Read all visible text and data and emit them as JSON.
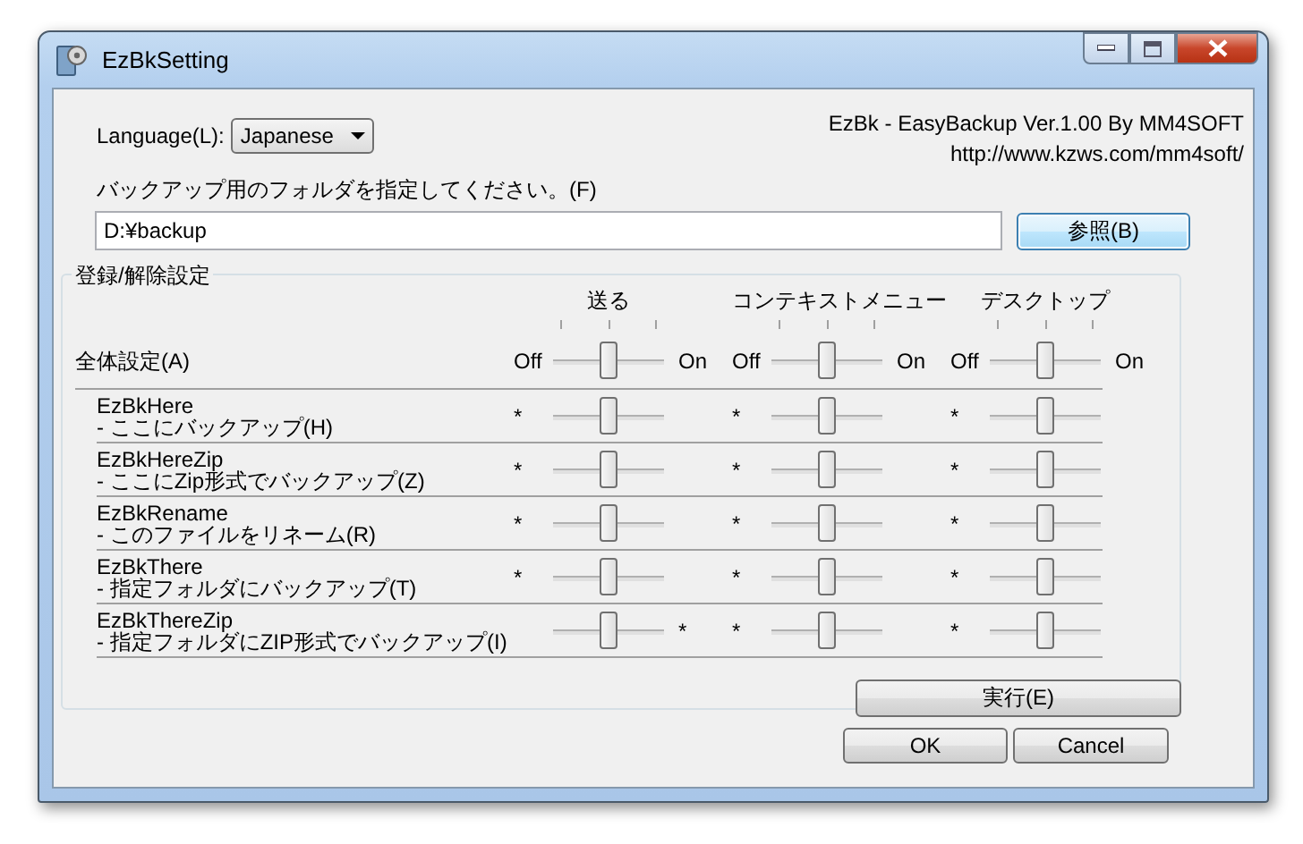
{
  "window": {
    "title": "EzBkSetting"
  },
  "language": {
    "label": "Language(L):",
    "value": "Japanese"
  },
  "about": [
    "EzBk - EasyBackup Ver.1.00 By MM4SOFT",
    "http://www.kzws.com/mm4soft/"
  ],
  "folder": {
    "label": "バックアップ用のフォルダを指定してください。(F)",
    "value": "D:¥backup",
    "browse_button": "参照(B)"
  },
  "group": {
    "title": "登録/解除設定",
    "columns": [
      "送る",
      "コンテキストメニュー",
      "デスクトップ"
    ],
    "all": {
      "label": "全体設定(A)",
      "cells": [
        {
          "left": "Off",
          "level": 0.5,
          "right": "On"
        },
        {
          "left": "Off",
          "level": 0.5,
          "right": "On"
        },
        {
          "left": "Off",
          "level": 0.5,
          "right": "On"
        }
      ]
    },
    "items": [
      {
        "name": "EzBkHere",
        "desc": "- ここにバックアップ(H)",
        "cells": [
          {
            "left": "*",
            "level": 0.5
          },
          {
            "left": "*",
            "level": 0.5
          },
          {
            "left": "*",
            "level": 0.5
          }
        ]
      },
      {
        "name": "EzBkHereZip",
        "desc": "- ここにZip形式でバックアップ(Z)",
        "cells": [
          {
            "left": "*",
            "level": 0.5
          },
          {
            "left": "*",
            "level": 0.5
          },
          {
            "left": "*",
            "level": 0.5
          }
        ]
      },
      {
        "name": "EzBkRename",
        "desc": "- このファイルをリネーム(R)",
        "cells": [
          {
            "left": "*",
            "level": 0.5
          },
          {
            "left": "*",
            "level": 0.5
          },
          {
            "left": "*",
            "level": 0.5
          }
        ]
      },
      {
        "name": "EzBkThere",
        "desc": "- 指定フォルダにバックアップ(T)",
        "cells": [
          {
            "left": "*",
            "level": 0.5
          },
          {
            "left": "*",
            "level": 0.5
          },
          {
            "left": "*",
            "level": 0.5
          }
        ]
      },
      {
        "name": "EzBkThereZip",
        "desc": "- 指定フォルダにZIP形式でバックアップ(I)",
        "cells": [
          {
            "level": 0.5,
            "right": "*"
          },
          {
            "left": "*",
            "level": 0.5
          },
          {
            "left": "*",
            "level": 0.5
          }
        ]
      }
    ],
    "run_button": "実行(E)"
  },
  "buttons": [
    "OK",
    "Cancel"
  ]
}
